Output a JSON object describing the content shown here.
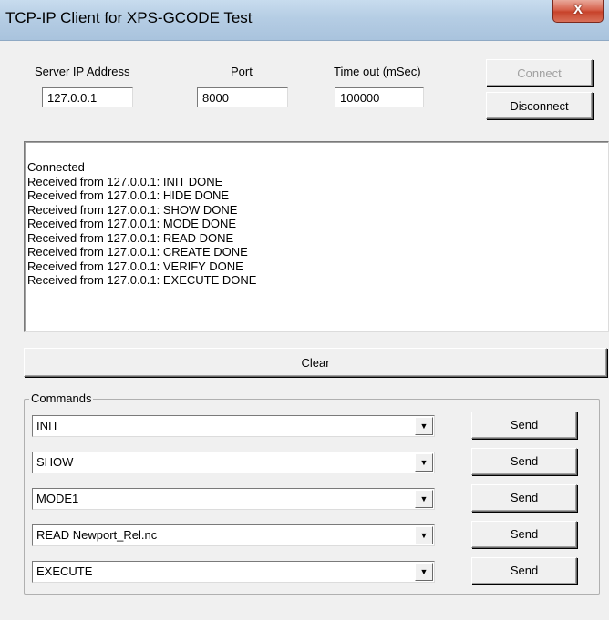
{
  "window": {
    "title": "TCP-IP Client for XPS-GCODE Test",
    "close_label": "X"
  },
  "connection": {
    "server_ip_label": "Server IP Address",
    "server_ip_value": "127.0.0.1",
    "port_label": "Port",
    "port_value": "8000",
    "timeout_label": "Time out (mSec)",
    "timeout_value": "100000",
    "connect_label": "Connect",
    "disconnect_label": "Disconnect"
  },
  "log": {
    "lines": [
      "Connected",
      "Received from 127.0.0.1: INIT DONE",
      "Received from 127.0.0.1: HIDE DONE",
      "Received from 127.0.0.1: SHOW DONE",
      "Received from 127.0.0.1: MODE DONE",
      "Received from 127.0.0.1: READ DONE",
      "Received from 127.0.0.1: CREATE DONE",
      "Received from 127.0.0.1: VERIFY DONE",
      "Received from 127.0.0.1: EXECUTE DONE"
    ]
  },
  "clear_label": "Clear",
  "commands": {
    "group_label": "Commands",
    "arrow_glyph": "▼",
    "rows": [
      {
        "value": "INIT",
        "send_label": "Send"
      },
      {
        "value": "SHOW",
        "send_label": "Send"
      },
      {
        "value": "MODE1",
        "send_label": "Send"
      },
      {
        "value": "READ Newport_Rel.nc",
        "send_label": "Send"
      },
      {
        "value": "EXECUTE",
        "send_label": "Send"
      }
    ]
  }
}
